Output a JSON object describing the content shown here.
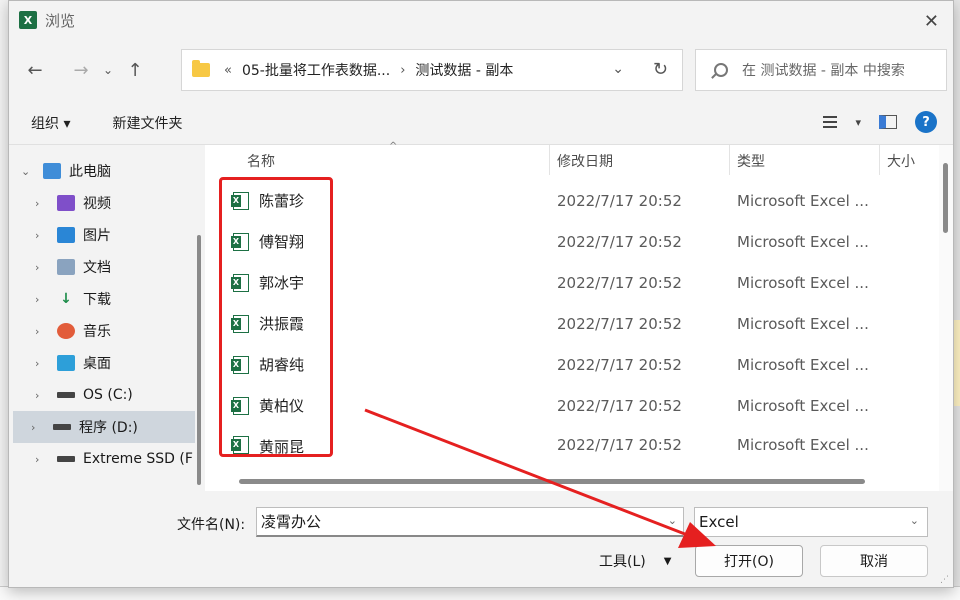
{
  "window": {
    "title": "浏览",
    "app_icon_letter": "X",
    "close_glyph": "✕"
  },
  "navigation": {
    "back": "←",
    "forward": "→",
    "recent": "⌄",
    "up": "↑",
    "breadcrumb_prefix": "«",
    "breadcrumbs": [
      "05-批量将工作表数据...",
      "测试数据 - 副本"
    ],
    "crumb_separator": "›",
    "dropdown": "⌄",
    "refresh": "↻",
    "search_placeholder": "在 测试数据 - 副本 中搜索"
  },
  "toolbar": {
    "organize": "组织 ▾",
    "new_folder": "新建文件夹",
    "view_dropdown": "▾",
    "help": "?"
  },
  "sidebar": {
    "items": [
      {
        "label": "此电脑",
        "chevron": "⌄",
        "icon": "pc-icon"
      },
      {
        "label": "视频",
        "chevron": "›",
        "icon": "video-icon"
      },
      {
        "label": "图片",
        "chevron": "›",
        "icon": "pictures-icon"
      },
      {
        "label": "文档",
        "chevron": "›",
        "icon": "documents-icon"
      },
      {
        "label": "下载",
        "chevron": "›",
        "icon": "download-icon",
        "glyph": "↓"
      },
      {
        "label": "音乐",
        "chevron": "›",
        "icon": "music-icon"
      },
      {
        "label": "桌面",
        "chevron": "›",
        "icon": "desktop-icon"
      },
      {
        "label": "OS (C:)",
        "chevron": "›",
        "icon": "drive-icon"
      },
      {
        "label": "程序 (D:)",
        "chevron": "›",
        "icon": "drive-icon",
        "selected": true
      },
      {
        "label": "Extreme SSD (F",
        "chevron": "›",
        "icon": "drive-icon"
      }
    ]
  },
  "file_list": {
    "columns": {
      "name": "名称",
      "modified": "修改日期",
      "type": "类型",
      "size": "大小"
    },
    "sort_indicator": "^",
    "files": [
      {
        "name": "陈蕾珍",
        "modified": "2022/7/17 20:52",
        "type": "Microsoft Excel ..."
      },
      {
        "name": "傅智翔",
        "modified": "2022/7/17 20:52",
        "type": "Microsoft Excel ..."
      },
      {
        "name": "郭冰宇",
        "modified": "2022/7/17 20:52",
        "type": "Microsoft Excel ..."
      },
      {
        "name": "洪振霞",
        "modified": "2022/7/17 20:52",
        "type": "Microsoft Excel ..."
      },
      {
        "name": "胡睿纯",
        "modified": "2022/7/17 20:52",
        "type": "Microsoft Excel ..."
      },
      {
        "name": "黄柏仪",
        "modified": "2022/7/17 20:52",
        "type": "Microsoft Excel ..."
      },
      {
        "name": "黄丽昆",
        "modified": "2022/7/17 20:52",
        "type": "Microsoft Excel ..."
      }
    ]
  },
  "bottom": {
    "filename_label": "文件名(N):",
    "filename_value": "凌霄办公",
    "filter_value": "Excel",
    "dropdown_glyph": "⌄",
    "tools_label": "工具(L)",
    "tools_dropdown": "▼",
    "open_button": "打开(O)",
    "cancel_button": "取消"
  },
  "colors": {
    "highlight_box": "#e52020",
    "arrow": "#e52020",
    "excel_green": "#1d7044",
    "selected_bg": "#cfd6dd"
  }
}
